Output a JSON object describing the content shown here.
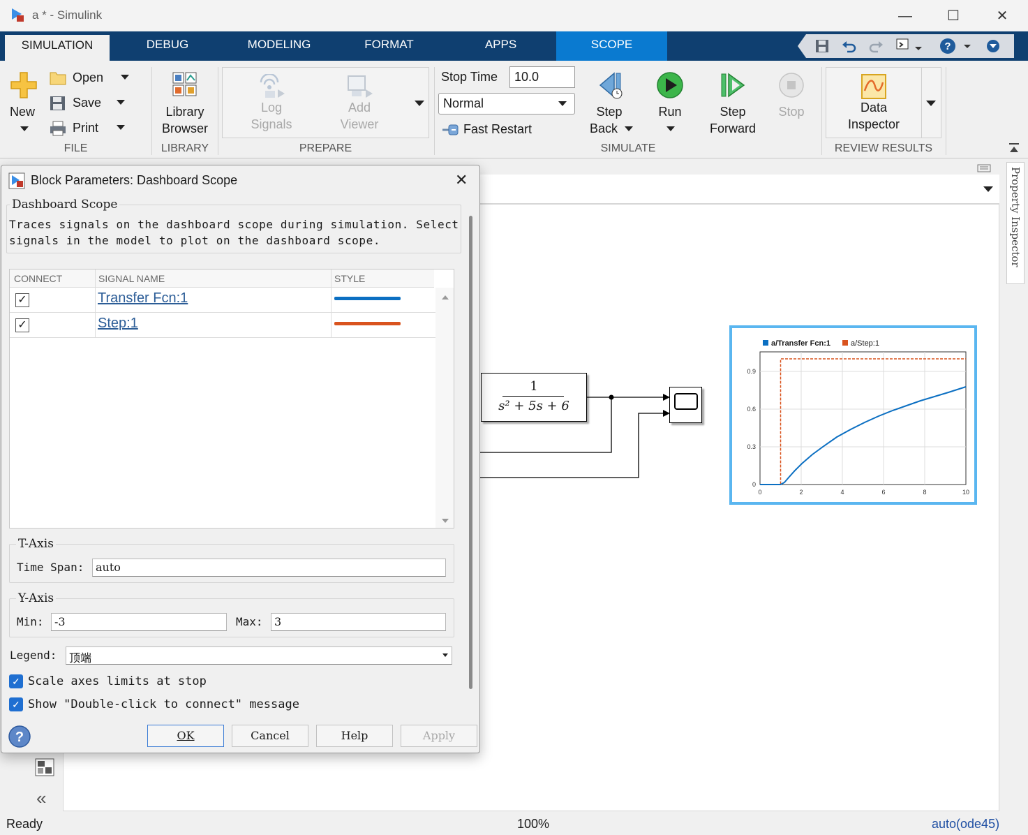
{
  "window": {
    "title": "a * - Simulink",
    "minimize": "—",
    "maximize": "☐",
    "close": "✕"
  },
  "tabs": [
    "SIMULATION",
    "DEBUG",
    "MODELING",
    "FORMAT",
    "APPS",
    "SCOPE"
  ],
  "ribbon": {
    "file": {
      "section": "FILE",
      "new": "New",
      "open": "Open",
      "save": "Save",
      "print": "Print"
    },
    "library": {
      "section": "LIBRARY",
      "library_browser_line1": "Library",
      "library_browser_line2": "Browser"
    },
    "prepare": {
      "section": "PREPARE",
      "log_signals_line1": "Log",
      "log_signals_line2": "Signals",
      "add_viewer_line1": "Add",
      "add_viewer_line2": "Viewer"
    },
    "simulate": {
      "section": "SIMULATE",
      "stop_time_label": "Stop Time",
      "stop_time_value": "10.0",
      "mode_value": "Normal",
      "fast_restart": "Fast Restart",
      "step_back_line1": "Step",
      "step_back_line2": "Back",
      "run": "Run",
      "step_forward_line1": "Step",
      "step_forward_line2": "Forward",
      "stop": "Stop"
    },
    "review": {
      "section": "REVIEW RESULTS",
      "data_inspector_line1": "Data",
      "data_inspector_line2": "Inspector"
    }
  },
  "property_inspector": "Property Inspector",
  "dialog": {
    "title": "Block Parameters: Dashboard Scope",
    "group_title": "Dashboard Scope",
    "description_line1": "Traces signals on the dashboard scope during simulation. Select",
    "description_line2": "signals in the model to plot on the dashboard scope.",
    "table": {
      "headers": [
        "CONNECT",
        "SIGNAL NAME",
        "STYLE"
      ],
      "rows": [
        {
          "connected": true,
          "signal": "Transfer Fcn:1",
          "color": "#0b6fc2"
        },
        {
          "connected": true,
          "signal": "Step:1",
          "color": "#d9531e"
        }
      ]
    },
    "t_axis": {
      "title": "T-Axis",
      "time_span_label": "Time Span:",
      "time_span_value": "auto"
    },
    "y_axis": {
      "title": "Y-Axis",
      "min_label": "Min:",
      "min_value": "-3",
      "max_label": "Max:",
      "max_value": "3"
    },
    "legend_label": "Legend:",
    "legend_value": "顶端",
    "scale_axes": "Scale axes limits at stop",
    "show_dbl_click": "Show \"Double-click to connect\" message",
    "buttons": {
      "ok": "OK",
      "cancel": "Cancel",
      "help": "Help",
      "apply": "Apply"
    }
  },
  "model": {
    "transfer_fcn_numerator": "1",
    "transfer_fcn_denominator": "s² + 5s + 6"
  },
  "scope_plot": {
    "legend": [
      "a/Transfer Fcn:1",
      "a/Step:1"
    ],
    "x_ticks": [
      "0",
      "2",
      "4",
      "6",
      "8",
      "10"
    ],
    "y_ticks": [
      "0",
      "0.3",
      "0.6",
      "0.9"
    ]
  },
  "status": {
    "left": "Ready",
    "zoom": "100%",
    "solver": "auto(ode45)"
  }
}
